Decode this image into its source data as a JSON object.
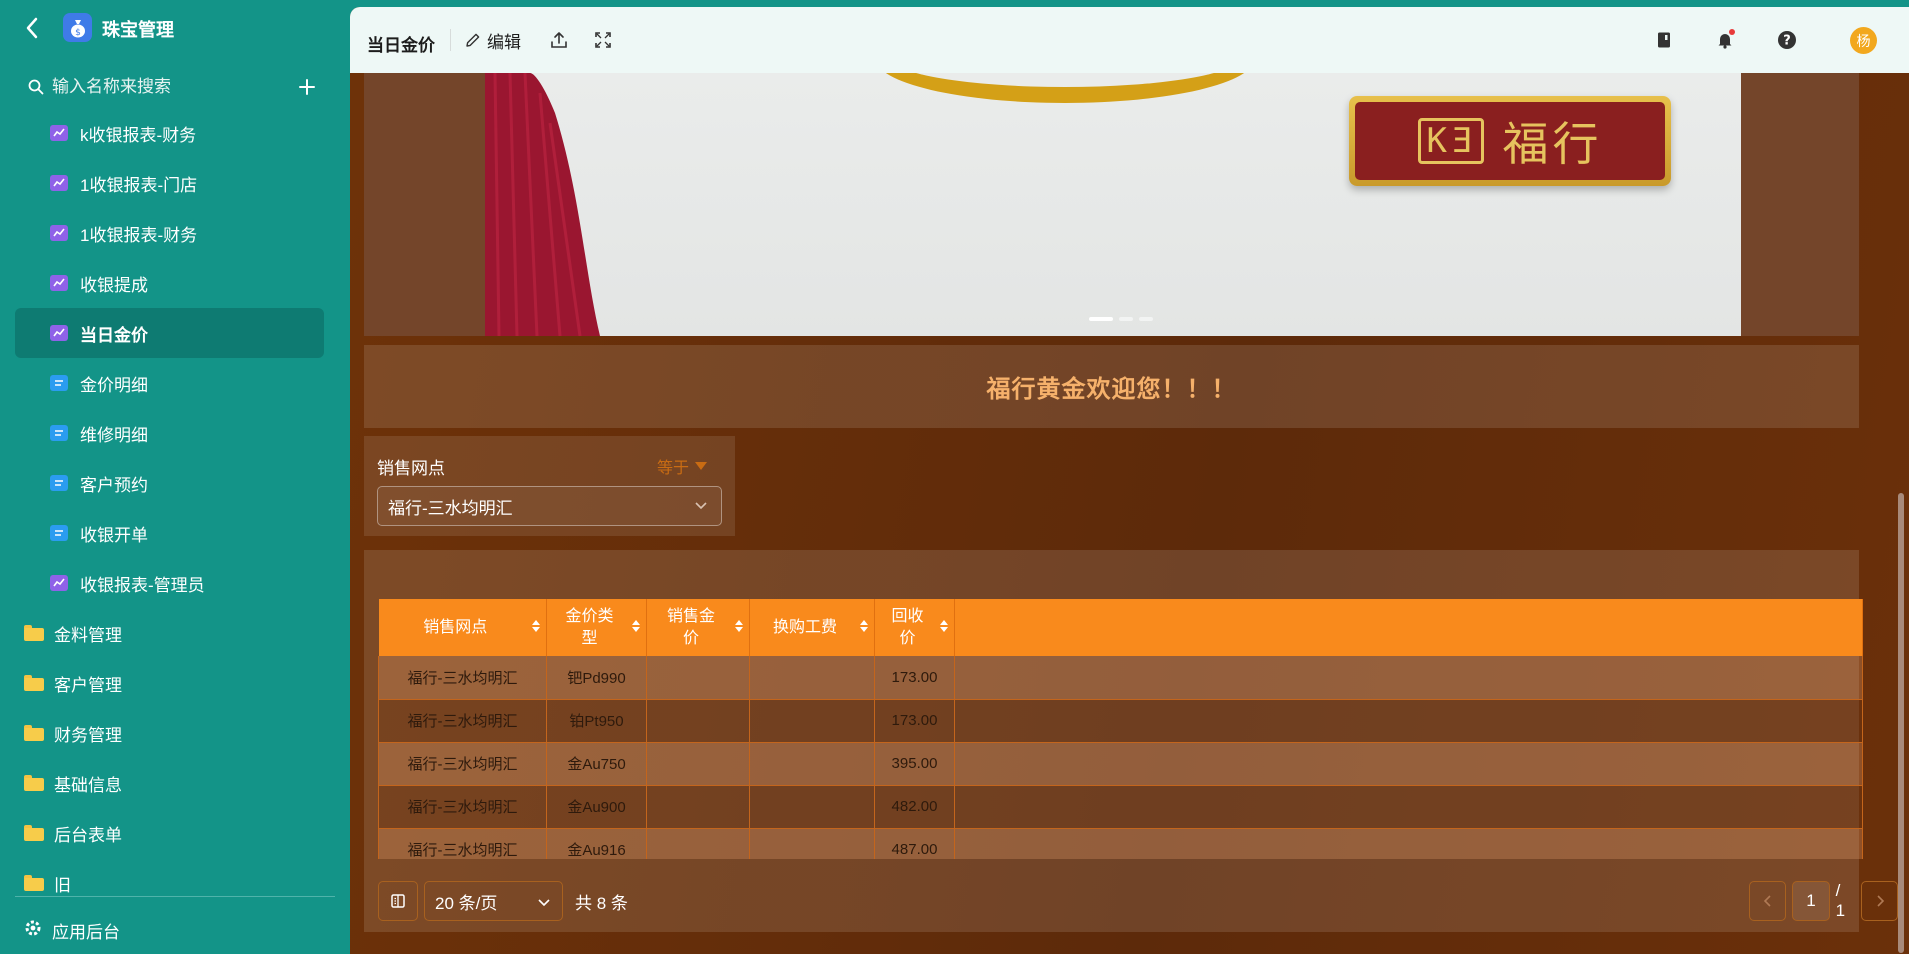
{
  "app": {
    "title": "珠宝管理"
  },
  "sidebar": {
    "search_placeholder": "输入名称来搜索",
    "items": [
      {
        "label": "k收银报表-财务",
        "icon": "chart-icon"
      },
      {
        "label": "1收银报表-门店",
        "icon": "chart-icon"
      },
      {
        "label": "1收银报表-财务",
        "icon": "chart-icon"
      },
      {
        "label": "收银提成",
        "icon": "chart-icon"
      },
      {
        "label": "当日金价",
        "icon": "chart-icon",
        "active": true
      },
      {
        "label": "金价明细",
        "icon": "document-icon"
      },
      {
        "label": "维修明细",
        "icon": "document-icon"
      },
      {
        "label": "客户预约",
        "icon": "document-icon"
      },
      {
        "label": "收银开单",
        "icon": "document-icon"
      },
      {
        "label": "收银报表-管理员",
        "icon": "chart-icon"
      }
    ],
    "folders": [
      {
        "label": "金料管理"
      },
      {
        "label": "客户管理"
      },
      {
        "label": "财务管理"
      },
      {
        "label": "基础信息"
      },
      {
        "label": "后台表单"
      },
      {
        "label": "旧"
      }
    ],
    "admin_label": "应用后台"
  },
  "toolbar": {
    "page_title": "当日金价",
    "edit_label": "编辑",
    "avatar_text": "杨"
  },
  "carousel": {
    "brand_logo": "KƎ",
    "brand_text": "福行",
    "slide_count": 3,
    "active_slide": 1
  },
  "banner": {
    "text": "福行黄金欢迎您！！！"
  },
  "filter": {
    "label": "销售网点",
    "operator": "等于",
    "value": "福行-三水均明汇"
  },
  "table": {
    "columns": [
      "销售网点",
      "金价类型",
      "销售金价",
      "换购工费",
      "回收价"
    ],
    "column_lines": [
      [
        "销售网点"
      ],
      [
        "金价类",
        "型"
      ],
      [
        "销售金",
        "价"
      ],
      [
        "换购工费"
      ],
      [
        "回收",
        "价"
      ]
    ],
    "rows": [
      [
        "福行-三水均明汇",
        "钯Pd990",
        "",
        "",
        "173.00"
      ],
      [
        "福行-三水均明汇",
        "铂Pt950",
        "",
        "",
        "173.00"
      ],
      [
        "福行-三水均明汇",
        "金Au750",
        "",
        "",
        "395.00"
      ],
      [
        "福行-三水均明汇",
        "金Au900",
        "",
        "",
        "482.00"
      ],
      [
        "福行-三水均明汇",
        "金Au916",
        "",
        "",
        "487.00"
      ]
    ]
  },
  "pagination": {
    "page_size": "20 条/页",
    "total": "共 8 条",
    "current_page": "1",
    "page_of": "/ 1"
  },
  "colors": {
    "sidebar": "#139488",
    "header_accent": "#f98a1c",
    "content_bg": "#6a2f08",
    "banner_text": "#f6b16b"
  }
}
